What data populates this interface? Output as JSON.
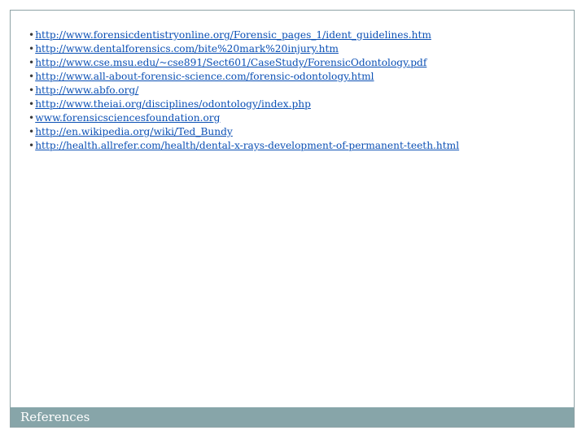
{
  "references": {
    "bullet": "•",
    "links": [
      "http://www.forensicdentistryonline.org/Forensic_pages_1/ident_guidelines.htm",
      "http://www.dentalforensics.com/bite%20mark%20injury.htm",
      "http://www.cse.msu.edu/~cse891/Sect601/CaseStudy/ForensicOdontology.pdf",
      "http://www.all-about-forensic-science.com/forensic-odontology.html",
      "http://www.abfo.org/",
      "http://www.theiai.org/disciplines/odontology/index.php",
      "www.forensicsciencesfoundation.org",
      "http://en.wikipedia.org/wiki/Ted_Bundy",
      "http://health.allrefer.com/health/dental-x-rays-development-of-permanent-teeth.html"
    ]
  },
  "footer": {
    "title": "References"
  },
  "colors": {
    "link": "#0a4fb4",
    "footer_bar": "#87a5a9",
    "frame_border": "#8fa3a6"
  }
}
